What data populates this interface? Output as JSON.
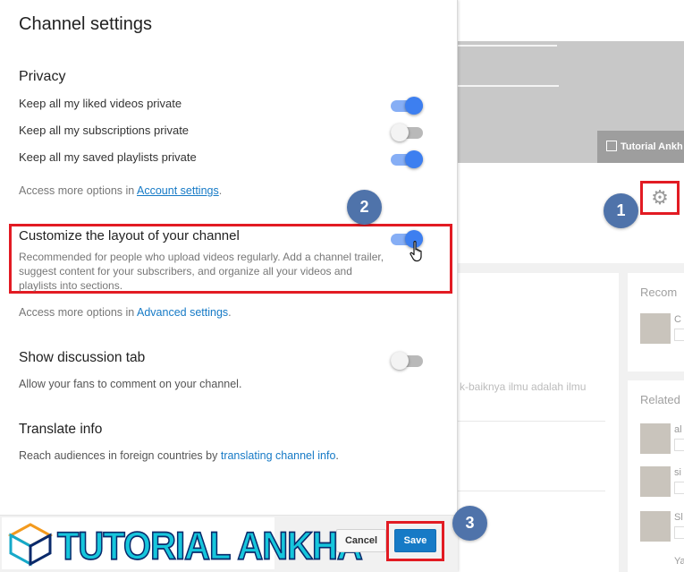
{
  "dialog": {
    "title": "Channel settings",
    "privacy": {
      "title": "Privacy",
      "options": [
        {
          "label": "Keep all my liked videos private",
          "enabled": true
        },
        {
          "label": "Keep all my subscriptions private",
          "enabled": false
        },
        {
          "label": "Keep all my saved playlists private",
          "enabled": true
        }
      ],
      "more_prefix": "Access more options in ",
      "more_link": "Account settings",
      "more_suffix": "."
    },
    "customize": {
      "title": "Customize the layout of your channel",
      "enabled": true,
      "description": "Recommended for people who upload videos regularly. Add a channel trailer, suggest content for your subscribers, and organize all your videos and playlists into sections.",
      "more_prefix": "Access more options in ",
      "more_link": "Advanced settings",
      "more_suffix": "."
    },
    "discussion": {
      "title": "Show discussion tab",
      "enabled": false,
      "description": "Allow your fans to comment on your channel."
    },
    "translate": {
      "title": "Translate info",
      "description_prefix": "Reach audiences in foreign countries by ",
      "link": "translating channel info",
      "suffix": "."
    },
    "buttons": {
      "cancel": "Cancel",
      "save": "Save"
    }
  },
  "watermark": {
    "text": "TUTORIAL ANKHA"
  },
  "markers": [
    "1",
    "2",
    "3"
  ],
  "background": {
    "banner_chip": "Tutorial Ankh",
    "snippet": "k-baiknya ilmu adalah ilmu",
    "recommended_label": "Recom",
    "related_label": "Related",
    "rec_item": "C",
    "related_items": [
      "al",
      "si",
      "Sl",
      "Ya"
    ]
  },
  "colors": {
    "accent": "#167ac6",
    "toggle_on": "#3d7ff0",
    "highlight": "#e21b23",
    "marker": "#4f73aa"
  }
}
